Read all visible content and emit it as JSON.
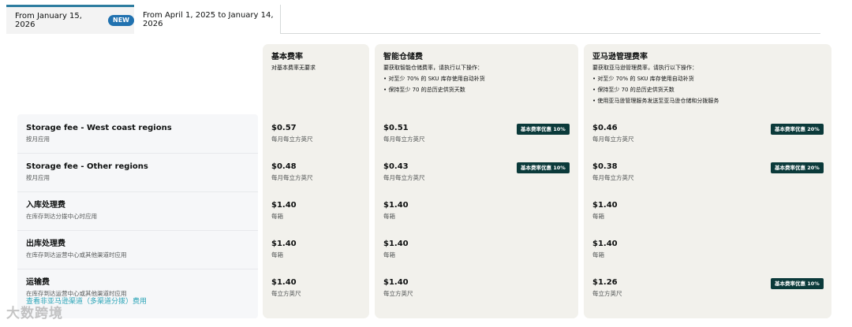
{
  "tabs": {
    "active": {
      "label": "From January 15, 2026",
      "badge": "NEW"
    },
    "inactive": {
      "label": "From April 1, 2025 to January 14, 2026"
    }
  },
  "columns": [
    {
      "title": "基本费率",
      "desc": [
        "对基本费率无要求"
      ]
    },
    {
      "title": "智能仓储费",
      "desc": [
        "要获取智能仓储费率，请执行以下操作：",
        "• 对至少 70% 的 SKU 库存使用自动补货",
        "• 保持至少 70 的总历史供货天数"
      ]
    },
    {
      "title": "亚马逊管理费率",
      "desc": [
        "要获取亚马逊管理费率，请执行以下操作：",
        "• 对至少 70% 的 SKU 库存使用自动补货",
        "• 保持至少 70 的总历史供货天数",
        "• 使用亚马逊管理服务发送至亚马逊仓储和分拨服务"
      ]
    }
  ],
  "rows": [
    {
      "title": "Storage fee - West coast regions",
      "sub": "按月应用",
      "cells": [
        {
          "price": "$0.57",
          "unit": "每月每立方英尺",
          "badge": ""
        },
        {
          "price": "$0.51",
          "unit": "每月每立方英尺",
          "badge": "基本费率优惠 10%"
        },
        {
          "price": "$0.46",
          "unit": "每月每立方英尺",
          "badge": "基本费率优惠 20%"
        }
      ]
    },
    {
      "title": "Storage fee - Other regions",
      "sub": "按月应用",
      "cells": [
        {
          "price": "$0.48",
          "unit": "每月每立方英尺",
          "badge": ""
        },
        {
          "price": "$0.43",
          "unit": "每月每立方英尺",
          "badge": "基本费率优惠 10%"
        },
        {
          "price": "$0.38",
          "unit": "每月每立方英尺",
          "badge": "基本费率优惠 20%"
        }
      ]
    },
    {
      "title": "入库处理费",
      "sub": "在库存到达分拨中心时应用",
      "cells": [
        {
          "price": "$1.40",
          "unit": "每箱",
          "badge": ""
        },
        {
          "price": "$1.40",
          "unit": "每箱",
          "badge": ""
        },
        {
          "price": "$1.40",
          "unit": "每箱",
          "badge": ""
        }
      ]
    },
    {
      "title": "出库处理费",
      "sub": "在库存到达运营中心或其他渠道时应用",
      "cells": [
        {
          "price": "$1.40",
          "unit": "每箱",
          "badge": ""
        },
        {
          "price": "$1.40",
          "unit": "每箱",
          "badge": ""
        },
        {
          "price": "$1.40",
          "unit": "每箱",
          "badge": ""
        }
      ]
    },
    {
      "title": "运输费",
      "sub": "在库存到达运营中心或其他渠道时应用",
      "link": "查看非亚马逊渠道（多渠道分拨）费用",
      "cells": [
        {
          "price": "$1.40",
          "unit": "每立方英尺",
          "badge": ""
        },
        {
          "price": "$1.40",
          "unit": "每立方英尺",
          "badge": ""
        },
        {
          "price": "$1.26",
          "unit": "每立方英尺",
          "badge": "基本费率优惠 10%"
        }
      ]
    }
  ],
  "watermark": "大数跨境"
}
